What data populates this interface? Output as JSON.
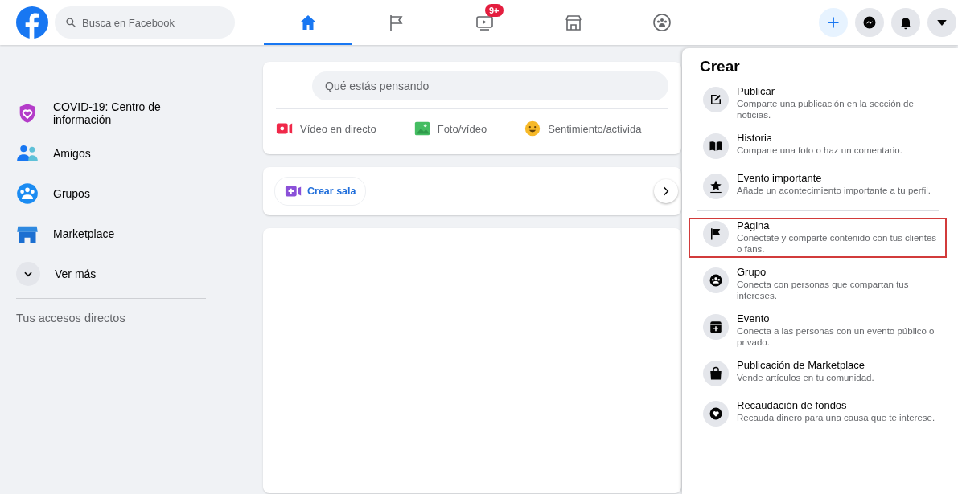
{
  "topbar": {
    "search": {
      "placeholder": "Busca en Facebook"
    },
    "tabs": [
      {
        "selected": true
      },
      {
        "selected": false
      },
      {
        "selected": false,
        "badge": "9+"
      },
      {
        "selected": false
      },
      {
        "selected": false
      }
    ],
    "actions": [
      {
        "selected": true
      },
      {
        "selected": false
      },
      {
        "selected": false
      },
      {
        "selected": false
      }
    ]
  },
  "sidebar": {
    "items": [
      "COVID-19: Centro de información",
      "Amigos",
      "Grupos",
      "Marketplace"
    ],
    "more": "Ver más",
    "section_title": "Tus accesos directos"
  },
  "composer": {
    "placeholder": "Qué estás pensando",
    "actions": [
      "Vídeo en directo",
      "Foto/vídeo",
      "Sentimiento/activida"
    ]
  },
  "rooms": {
    "button": "Crear sala"
  },
  "create_menu": {
    "title": "Crear",
    "sections": [
      [
        {
          "title": "Publicar",
          "description": "Comparte una publicación en la sección de noticias.",
          "highlighted": false
        },
        {
          "title": "Historia",
          "description": "Comparte una foto o haz un comentario.",
          "highlighted": false
        },
        {
          "title": "Evento importante",
          "description": "Añade un acontecimiento importante a tu perfil.",
          "highlighted": false
        }
      ],
      [
        {
          "title": "Página",
          "description": "Conéctate y comparte contenido con tus clientes o fans.",
          "highlighted": true
        },
        {
          "title": "Grupo",
          "description": "Conecta con personas que compartan tus intereses.",
          "highlighted": false
        },
        {
          "title": "Evento",
          "description": "Conecta a las personas con un evento público o privado.",
          "highlighted": false
        },
        {
          "title": "Publicación de Marketplace",
          "description": "Vende artículos en tu comunidad.",
          "highlighted": false
        },
        {
          "title": "Recaudación de fondos",
          "description": "Recauda dinero para una causa que te interese.",
          "highlighted": false
        }
      ]
    ]
  }
}
